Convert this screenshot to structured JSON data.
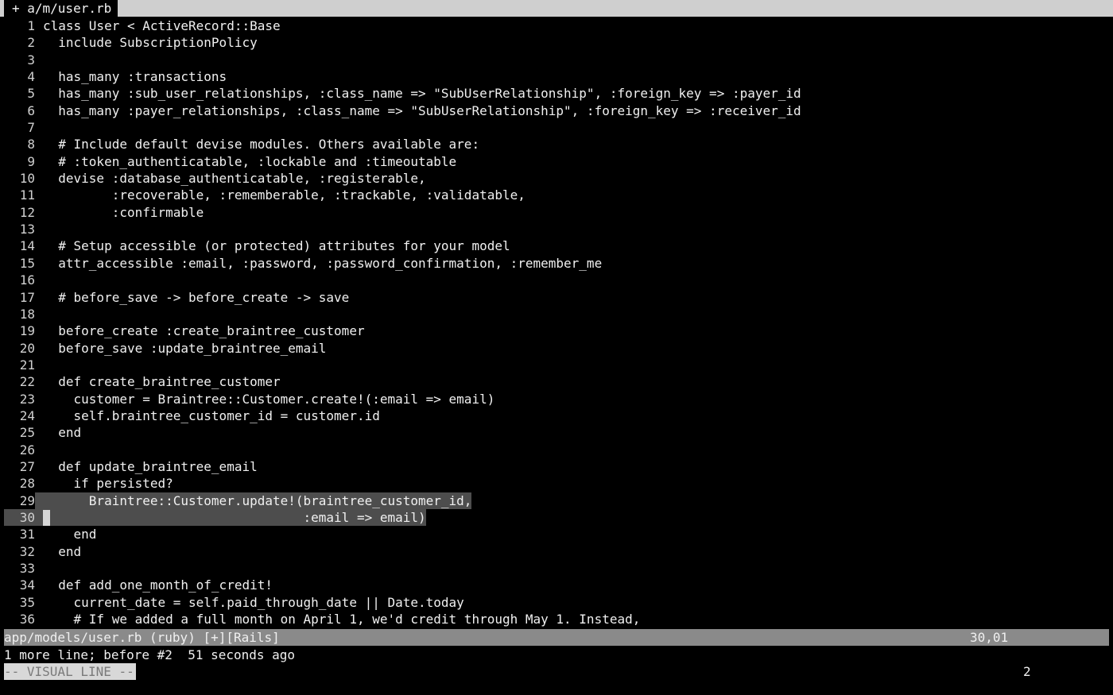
{
  "tabline": {
    "active_tab": "+ a/m/user.rb"
  },
  "lines": [
    {
      "n": "1",
      "t": "class User < ActiveRecord::Base"
    },
    {
      "n": "2",
      "t": "  include SubscriptionPolicy"
    },
    {
      "n": "3",
      "t": ""
    },
    {
      "n": "4",
      "t": "  has_many :transactions"
    },
    {
      "n": "5",
      "t": "  has_many :sub_user_relationships, :class_name => \"SubUserRelationship\", :foreign_key => :payer_id"
    },
    {
      "n": "6",
      "t": "  has_many :payer_relationships, :class_name => \"SubUserRelationship\", :foreign_key => :receiver_id"
    },
    {
      "n": "7",
      "t": ""
    },
    {
      "n": "8",
      "t": "  # Include default devise modules. Others available are:"
    },
    {
      "n": "9",
      "t": "  # :token_authenticatable, :lockable and :timeoutable"
    },
    {
      "n": "10",
      "t": "  devise :database_authenticatable, :registerable,"
    },
    {
      "n": "11",
      "t": "         :recoverable, :rememberable, :trackable, :validatable,"
    },
    {
      "n": "12",
      "t": "         :confirmable"
    },
    {
      "n": "13",
      "t": ""
    },
    {
      "n": "14",
      "t": "  # Setup accessible (or protected) attributes for your model"
    },
    {
      "n": "15",
      "t": "  attr_accessible :email, :password, :password_confirmation, :remember_me"
    },
    {
      "n": "16",
      "t": ""
    },
    {
      "n": "17",
      "t": "  # before_save -> before_create -> save"
    },
    {
      "n": "18",
      "t": ""
    },
    {
      "n": "19",
      "t": "  before_create :create_braintree_customer"
    },
    {
      "n": "20",
      "t": "  before_save :update_braintree_email"
    },
    {
      "n": "21",
      "t": ""
    },
    {
      "n": "22",
      "t": "  def create_braintree_customer"
    },
    {
      "n": "23",
      "t": "    customer = Braintree::Customer.create!(:email => email)"
    },
    {
      "n": "24",
      "t": "    self.braintree_customer_id = customer.id"
    },
    {
      "n": "25",
      "t": "  end"
    },
    {
      "n": "26",
      "t": ""
    },
    {
      "n": "27",
      "t": "  def update_braintree_email"
    },
    {
      "n": "28",
      "t": "    if persisted?"
    },
    {
      "n": "29",
      "t": "      Braintree::Customer.update!(braintree_customer_id,",
      "selected": true
    },
    {
      "n": "30",
      "t": "                                  :email => email)",
      "selected": true,
      "cursor": true
    },
    {
      "n": "31",
      "t": "    end"
    },
    {
      "n": "32",
      "t": "  end"
    },
    {
      "n": "33",
      "t": ""
    },
    {
      "n": "34",
      "t": "  def add_one_month_of_credit!"
    },
    {
      "n": "35",
      "t": "    current_date = self.paid_through_date || Date.today"
    },
    {
      "n": "36",
      "t": "    # If we added a full month on April 1, we'd credit through May 1. Instead,"
    }
  ],
  "statusline": {
    "file": "app/models/user.rb (ruby) [+][Rails]",
    "position": "30,01"
  },
  "message": "1 more line; before #2  51 seconds ago",
  "mode": "-- VISUAL LINE --",
  "selection_count": "2",
  "colors": {
    "background": "#000000",
    "selection": "#4d4d4d",
    "statusline": "#8a8a8a",
    "tabline": "#cfcfcf"
  }
}
